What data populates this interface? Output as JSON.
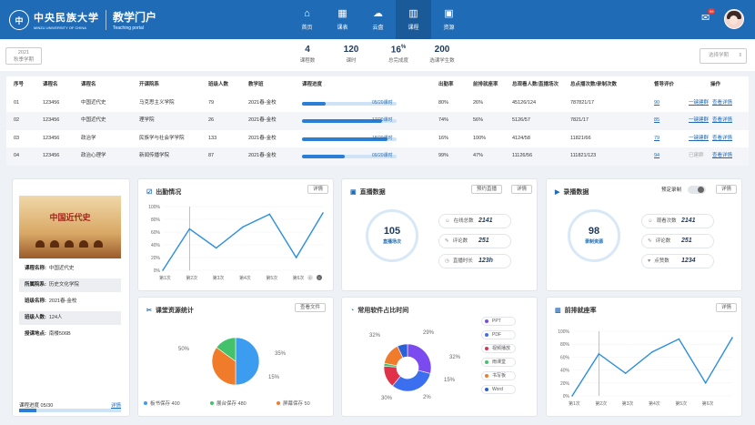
{
  "header": {
    "logo_mark": "中",
    "university_name": "中央民族大学",
    "university_en": "MINZU UNIVERSITY OF CHINA",
    "portal_title": "教学门户",
    "portal_en": "Teaching portal",
    "mail_badge": "99",
    "nav": [
      {
        "label": "首页",
        "icon": "home-icon",
        "glyph": "⌂"
      },
      {
        "label": "课表",
        "icon": "calendar-icon",
        "glyph": "▦"
      },
      {
        "label": "云盘",
        "icon": "cloud-icon",
        "glyph": "☁"
      },
      {
        "label": "课程",
        "icon": "chart-icon",
        "glyph": "▥"
      },
      {
        "label": "资源",
        "icon": "video-icon",
        "glyph": "▣"
      }
    ],
    "active_nav": "课程"
  },
  "stats_bar": {
    "term_line1": "2021",
    "term_line2": "秋季学期",
    "select_placeholder": "选择学期",
    "select_arrow": "⇕",
    "stats": [
      {
        "value": "4",
        "label": "课程数"
      },
      {
        "value": "120",
        "label": "课时"
      },
      {
        "value": "16",
        "sup": "%",
        "label": "总完成度"
      },
      {
        "value": "200",
        "label": "选课学生数"
      }
    ]
  },
  "table": {
    "headers": [
      "序号",
      "课程名",
      "课程名",
      "开课院系",
      "班级人数",
      "教学班",
      "课程进度",
      "出勤率",
      "前排就座率",
      "总观看人数/直播场次",
      "总点播次数/录制次数",
      "督导评价",
      "操作"
    ],
    "rows": [
      {
        "no": "01",
        "code": "123456",
        "name": "中国近代史",
        "dept": "马克思主义学院",
        "size": "79",
        "cls": "2021春-金校",
        "prog_text": "05/20课时",
        "prog": 0.25,
        "att": "80%",
        "front": "26%",
        "live": "45126/124",
        "vod": "787821/17",
        "eval": "90",
        "op1": "一键建群",
        "op1_state": "link",
        "op2": "查看详情"
      },
      {
        "no": "02",
        "code": "123456",
        "name": "中国近代史",
        "dept": "理学院",
        "size": "26",
        "cls": "2021春-金校",
        "prog_text": "17/20课时",
        "prog": 0.85,
        "att": "74%",
        "front": "56%",
        "live": "5126/57",
        "vod": "7821/17",
        "eval": "85",
        "op1": "一键建群",
        "op1_state": "link",
        "op2": "查看详情"
      },
      {
        "no": "03",
        "code": "123456",
        "name": "政治学",
        "dept": "民族学与社会学学院",
        "size": "133",
        "cls": "2021春-金校",
        "prog_text": "18/20课时",
        "prog": 0.9,
        "att": "16%",
        "front": "100%",
        "live": "4124/58",
        "vod": "11821/66",
        "eval": "79",
        "op1": "一键建群",
        "op1_state": "link",
        "op2": "查看详情"
      },
      {
        "no": "04",
        "code": "123456",
        "name": "政治心理学",
        "dept": "新闻传播学院",
        "size": "87",
        "cls": "2021春-金校",
        "prog_text": "09/20课时",
        "prog": 0.45,
        "att": "99%",
        "front": "47%",
        "live": "11126/56",
        "vod": "111821/123",
        "eval": "94",
        "op1": "已建群",
        "op1_state": "muted",
        "op2": "查看详情"
      }
    ]
  },
  "course_card": {
    "cover_title": "中国近代史",
    "fields": [
      {
        "k": "课程名称:",
        "v": "中国近代史"
      },
      {
        "k": "所属院系:",
        "v": "历史文化学院"
      },
      {
        "k": "班级名称:",
        "v": "2021春-金校"
      },
      {
        "k": "班级人数:",
        "v": "124人"
      },
      {
        "k": "授课地点:",
        "v": "南楼506B"
      }
    ],
    "progress_label": "课程进度 05/30",
    "progress": 0.1667,
    "detail": "详情"
  },
  "attendance": {
    "title": "出勤情况",
    "detail": "详情",
    "page_prev": "‹",
    "page_next": "›"
  },
  "live": {
    "title": "直播数据",
    "btn_book": "预约直播",
    "btn_detail": "详情",
    "ring_value": "105",
    "ring_label": "直播场次",
    "items": [
      {
        "label": "在线总数",
        "value": "2141",
        "icon": "users-icon",
        "glyph": "☺"
      },
      {
        "label": "评论数",
        "value": "251",
        "icon": "comment-icon",
        "glyph": "✎"
      },
      {
        "label": "直播时长",
        "value": "123h",
        "icon": "clock-icon",
        "glyph": "◷"
      }
    ]
  },
  "record": {
    "title": "录播数据",
    "toggle_label": "预定录制",
    "detail": "详情",
    "ring_value": "98",
    "ring_label": "录制资源",
    "items": [
      {
        "label": "观看次数",
        "value": "2141",
        "icon": "users-icon",
        "glyph": "☺"
      },
      {
        "label": "评论数",
        "value": "251",
        "icon": "comment-icon",
        "glyph": "✎"
      },
      {
        "label": "点赞数",
        "value": "1234",
        "icon": "like-icon",
        "glyph": "♥"
      }
    ]
  },
  "resources": {
    "title": "课堂资源统计",
    "btn": "查看文件",
    "legend": [
      {
        "label": "板书保存",
        "value": "400",
        "color": "#3b9cf0"
      },
      {
        "label": "展台保存",
        "value": "480",
        "color": "#43c26b"
      },
      {
        "label": "屏幕保存",
        "value": "50",
        "color": "#f07b2b"
      }
    ]
  },
  "software": {
    "title": "常用软件占比时间",
    "legend": [
      {
        "label": "PPT",
        "color": "#7b4bf0"
      },
      {
        "label": "PDF",
        "color": "#3b6ff0"
      },
      {
        "label": "视频播放",
        "color": "#e0304a"
      },
      {
        "label": "雨课堂",
        "color": "#43c26b"
      },
      {
        "label": "书写板",
        "color": "#f07b2b"
      },
      {
        "label": "Word",
        "color": "#2a5fd5"
      }
    ]
  },
  "front_rate": {
    "title": "前排就座率",
    "detail": "详情"
  },
  "chart_data": [
    {
      "type": "line",
      "title": "出勤情况",
      "categories": [
        "第1次",
        "第2次",
        "第3次",
        "第4次",
        "第5次",
        "第6次"
      ],
      "values": [
        0,
        65,
        35,
        68,
        88,
        20,
        90
      ],
      "yticks": [
        "100%",
        "80%",
        "60%",
        "40%",
        "20%",
        "0%"
      ],
      "ylim": [
        0,
        100
      ],
      "marker_index": 1
    },
    {
      "type": "pie",
      "title": "课堂资源统计",
      "labels": [
        "50%",
        "35%",
        "15%"
      ],
      "slices": [
        {
          "name": "板书保存",
          "value": 50,
          "color": "#3b9cf0"
        },
        {
          "name": "屏幕保存",
          "value": 35,
          "color": "#f07b2b"
        },
        {
          "name": "展台保存",
          "value": 15,
          "color": "#43c26b"
        }
      ]
    },
    {
      "type": "pie",
      "title": "常用软件占比时间",
      "donut": true,
      "labels": [
        "29%",
        "32%",
        "15%",
        "2%",
        "30%",
        "32%"
      ],
      "slices": [
        {
          "name": "PPT",
          "value": 29,
          "color": "#7b4bf0"
        },
        {
          "name": "PDF",
          "value": 32,
          "color": "#3b6ff0"
        },
        {
          "name": "视频播放",
          "value": 15,
          "color": "#e0304a"
        },
        {
          "name": "雨课堂",
          "value": 2,
          "color": "#43c26b"
        },
        {
          "name": "书写板",
          "value": 15,
          "color": "#f07b2b"
        },
        {
          "name": "Word",
          "value": 7,
          "color": "#2a5fd5"
        }
      ]
    },
    {
      "type": "line",
      "title": "前排就座率",
      "categories": [
        "第1次",
        "第2次",
        "第3次",
        "第4次",
        "第5次",
        "第6次"
      ],
      "values": [
        0,
        65,
        35,
        68,
        88,
        20,
        90
      ],
      "yticks": [
        "100%",
        "80%",
        "60%",
        "40%",
        "20%",
        "0%"
      ],
      "ylim": [
        0,
        100
      ],
      "marker_index": 1
    }
  ]
}
